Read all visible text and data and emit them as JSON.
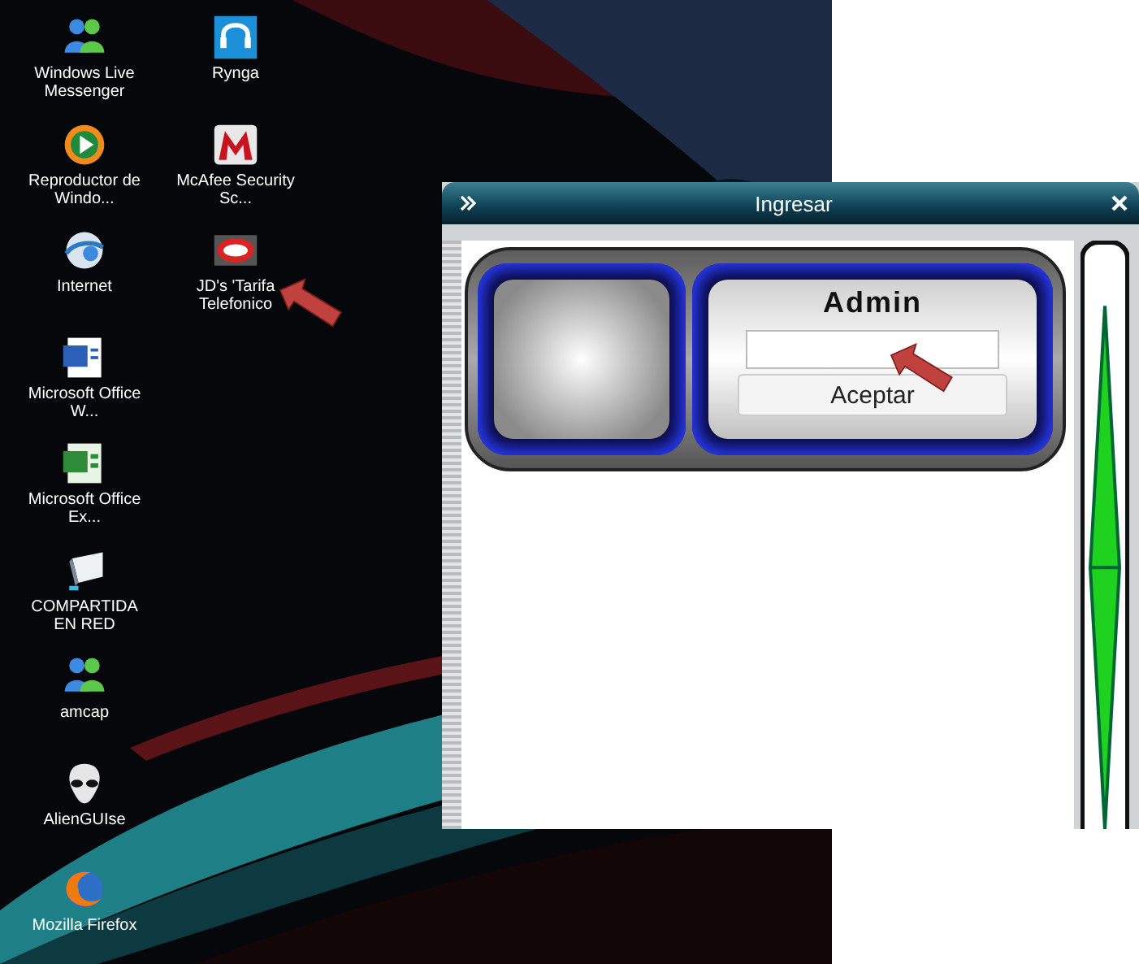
{
  "desktop": {
    "icon_columns": [
      [
        {
          "label": "Windows Live Messenger"
        },
        {
          "label": "Reproductor de Windo..."
        },
        {
          "label": "Internet"
        },
        {
          "label": "Microsoft Office W..."
        },
        {
          "label": "Microsoft Office Ex..."
        },
        {
          "label": "COMPARTIDA EN RED"
        },
        {
          "label": "amcap"
        },
        {
          "label": "AlienGUIse"
        },
        {
          "label": "Mozilla Firefox"
        }
      ],
      [
        {
          "label": "Rynga"
        },
        {
          "label": "McAfee Security Sc..."
        },
        {
          "label": "JD's 'Tarifa Telefonico"
        }
      ]
    ]
  },
  "window": {
    "title": "Ingresar",
    "user_name": "Admin",
    "button": "Aceptar"
  }
}
